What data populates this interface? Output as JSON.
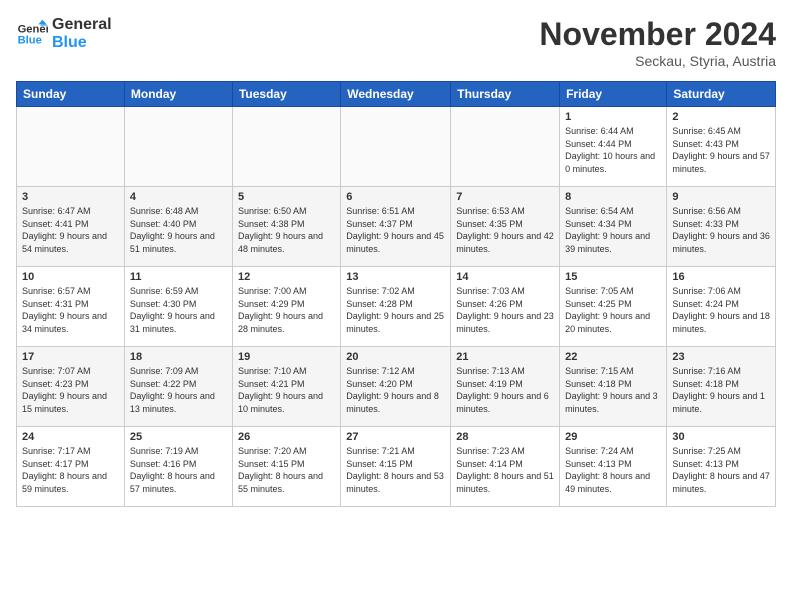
{
  "logo": {
    "line1": "General",
    "line2": "Blue"
  },
  "header": {
    "title": "November 2024",
    "subtitle": "Seckau, Styria, Austria"
  },
  "days_of_week": [
    "Sunday",
    "Monday",
    "Tuesday",
    "Wednesday",
    "Thursday",
    "Friday",
    "Saturday"
  ],
  "weeks": [
    [
      {
        "day": "",
        "info": ""
      },
      {
        "day": "",
        "info": ""
      },
      {
        "day": "",
        "info": ""
      },
      {
        "day": "",
        "info": ""
      },
      {
        "day": "",
        "info": ""
      },
      {
        "day": "1",
        "info": "Sunrise: 6:44 AM\nSunset: 4:44 PM\nDaylight: 10 hours and 0 minutes."
      },
      {
        "day": "2",
        "info": "Sunrise: 6:45 AM\nSunset: 4:43 PM\nDaylight: 9 hours and 57 minutes."
      }
    ],
    [
      {
        "day": "3",
        "info": "Sunrise: 6:47 AM\nSunset: 4:41 PM\nDaylight: 9 hours and 54 minutes."
      },
      {
        "day": "4",
        "info": "Sunrise: 6:48 AM\nSunset: 4:40 PM\nDaylight: 9 hours and 51 minutes."
      },
      {
        "day": "5",
        "info": "Sunrise: 6:50 AM\nSunset: 4:38 PM\nDaylight: 9 hours and 48 minutes."
      },
      {
        "day": "6",
        "info": "Sunrise: 6:51 AM\nSunset: 4:37 PM\nDaylight: 9 hours and 45 minutes."
      },
      {
        "day": "7",
        "info": "Sunrise: 6:53 AM\nSunset: 4:35 PM\nDaylight: 9 hours and 42 minutes."
      },
      {
        "day": "8",
        "info": "Sunrise: 6:54 AM\nSunset: 4:34 PM\nDaylight: 9 hours and 39 minutes."
      },
      {
        "day": "9",
        "info": "Sunrise: 6:56 AM\nSunset: 4:33 PM\nDaylight: 9 hours and 36 minutes."
      }
    ],
    [
      {
        "day": "10",
        "info": "Sunrise: 6:57 AM\nSunset: 4:31 PM\nDaylight: 9 hours and 34 minutes."
      },
      {
        "day": "11",
        "info": "Sunrise: 6:59 AM\nSunset: 4:30 PM\nDaylight: 9 hours and 31 minutes."
      },
      {
        "day": "12",
        "info": "Sunrise: 7:00 AM\nSunset: 4:29 PM\nDaylight: 9 hours and 28 minutes."
      },
      {
        "day": "13",
        "info": "Sunrise: 7:02 AM\nSunset: 4:28 PM\nDaylight: 9 hours and 25 minutes."
      },
      {
        "day": "14",
        "info": "Sunrise: 7:03 AM\nSunset: 4:26 PM\nDaylight: 9 hours and 23 minutes."
      },
      {
        "day": "15",
        "info": "Sunrise: 7:05 AM\nSunset: 4:25 PM\nDaylight: 9 hours and 20 minutes."
      },
      {
        "day": "16",
        "info": "Sunrise: 7:06 AM\nSunset: 4:24 PM\nDaylight: 9 hours and 18 minutes."
      }
    ],
    [
      {
        "day": "17",
        "info": "Sunrise: 7:07 AM\nSunset: 4:23 PM\nDaylight: 9 hours and 15 minutes."
      },
      {
        "day": "18",
        "info": "Sunrise: 7:09 AM\nSunset: 4:22 PM\nDaylight: 9 hours and 13 minutes."
      },
      {
        "day": "19",
        "info": "Sunrise: 7:10 AM\nSunset: 4:21 PM\nDaylight: 9 hours and 10 minutes."
      },
      {
        "day": "20",
        "info": "Sunrise: 7:12 AM\nSunset: 4:20 PM\nDaylight: 9 hours and 8 minutes."
      },
      {
        "day": "21",
        "info": "Sunrise: 7:13 AM\nSunset: 4:19 PM\nDaylight: 9 hours and 6 minutes."
      },
      {
        "day": "22",
        "info": "Sunrise: 7:15 AM\nSunset: 4:18 PM\nDaylight: 9 hours and 3 minutes."
      },
      {
        "day": "23",
        "info": "Sunrise: 7:16 AM\nSunset: 4:18 PM\nDaylight: 9 hours and 1 minute."
      }
    ],
    [
      {
        "day": "24",
        "info": "Sunrise: 7:17 AM\nSunset: 4:17 PM\nDaylight: 8 hours and 59 minutes."
      },
      {
        "day": "25",
        "info": "Sunrise: 7:19 AM\nSunset: 4:16 PM\nDaylight: 8 hours and 57 minutes."
      },
      {
        "day": "26",
        "info": "Sunrise: 7:20 AM\nSunset: 4:15 PM\nDaylight: 8 hours and 55 minutes."
      },
      {
        "day": "27",
        "info": "Sunrise: 7:21 AM\nSunset: 4:15 PM\nDaylight: 8 hours and 53 minutes."
      },
      {
        "day": "28",
        "info": "Sunrise: 7:23 AM\nSunset: 4:14 PM\nDaylight: 8 hours and 51 minutes."
      },
      {
        "day": "29",
        "info": "Sunrise: 7:24 AM\nSunset: 4:13 PM\nDaylight: 8 hours and 49 minutes."
      },
      {
        "day": "30",
        "info": "Sunrise: 7:25 AM\nSunset: 4:13 PM\nDaylight: 8 hours and 47 minutes."
      }
    ]
  ]
}
